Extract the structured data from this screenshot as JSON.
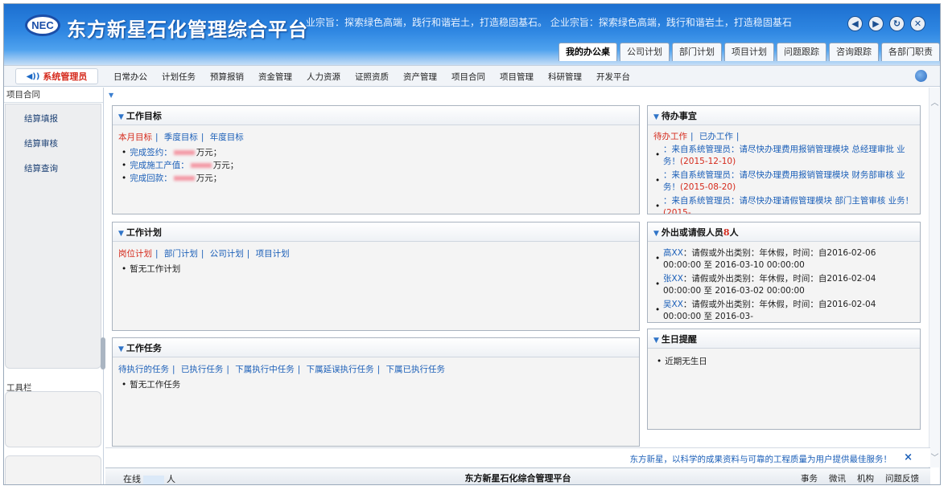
{
  "header": {
    "logo_text": "NEC",
    "title": "东方新星石化管理综合平台",
    "slogan": "业宗旨：探索绿色高端，践行和谐岩土，打造稳固基石。 企业宗旨：探索绿色高端，践行和谐岩土，打造稳固基石",
    "window_controls": [
      "back-icon",
      "forward-icon",
      "refresh-icon",
      "close-icon"
    ],
    "tabs": [
      {
        "label": "我的办公桌",
        "active": true
      },
      {
        "label": "公司计划"
      },
      {
        "label": "部门计划"
      },
      {
        "label": "项目计划"
      },
      {
        "label": "问题跟踪"
      },
      {
        "label": "咨询跟踪"
      },
      {
        "label": "各部门职责"
      }
    ]
  },
  "navbar": {
    "user_label": "系统管理员",
    "items": [
      "日常办公",
      "计划任务",
      "预算报销",
      "资金管理",
      "人力资源",
      "证照资质",
      "资产管理",
      "项目合同",
      "项目管理",
      "科研管理",
      "开发平台"
    ]
  },
  "sidebar": {
    "section_title": "项目合同",
    "items": [
      "结算填报",
      "结算审核",
      "结算查询"
    ],
    "toolbar_label": "工具栏"
  },
  "panels": {
    "work_goal": {
      "title": "工作目标",
      "tabs": [
        "本月目标",
        "季度目标",
        "年度目标"
      ],
      "items": [
        {
          "label": "完成签约：",
          "suffix": "万元；"
        },
        {
          "label": "完成施工产值：",
          "suffix": "万元；"
        },
        {
          "label": "完成回款：",
          "suffix": "万元；"
        }
      ]
    },
    "work_plan": {
      "title": "工作计划",
      "tabs": [
        "岗位计划",
        "部门计划",
        "公司计划",
        "项目计划"
      ],
      "empty_text": "暂无工作计划"
    },
    "work_task": {
      "title": "工作任务",
      "tabs": [
        "待执行的任务",
        "已执行任务",
        "下属执行中任务",
        "下属延误执行任务",
        "下属已执行任务"
      ],
      "empty_text": "暂无工作任务"
    },
    "todo": {
      "title": "待办事宜",
      "tabs": [
        "待办工作",
        "已办工作"
      ],
      "items": [
        {
          "msg": "：来自系统管理员：请尽快办理费用报销管理模块 总经理审批 业务！",
          "date": "(2015-12-10)"
        },
        {
          "msg": "：来自系统管理员：请尽快办理费用报销管理模块 财务部审核 业务！",
          "date": "(2015-08-20)"
        },
        {
          "msg": "：来自系统管理员：请尽快办理请假管理模块 部门主管审核 业务！",
          "date": "(2015-"
        }
      ]
    },
    "leave": {
      "title_prefix": "外出或请假人员",
      "count": "8",
      "title_suffix": "人",
      "items": [
        {
          "name": "高XX",
          "text": "：请假或外出类别：年休假，时间：自2016-02-06 00:00:00 至 2016-03-10 00:00:00"
        },
        {
          "name": "张XX",
          "text": "：请假或外出类别：年休假，时间：自2016-02-04 00:00:00 至 2016-03-02 00:00:00"
        },
        {
          "name": "吴XX",
          "text": "：请假或外出类别：年休假，时间：自2016-02-04 00:00:00 至 2016-03-"
        }
      ]
    },
    "birthday": {
      "title": "生日提醒",
      "empty_text": "近期无生日"
    }
  },
  "notice": {
    "text": "东方新星，以科学的成果资料与可靠的工程质量为用户提供最佳服务！"
  },
  "statusbar": {
    "online_prefix": "在线",
    "online_suffix": "人",
    "title": "东方新星石化综合管理平台",
    "links": [
      "事务",
      "微讯",
      "机构",
      "问题反馈"
    ]
  }
}
